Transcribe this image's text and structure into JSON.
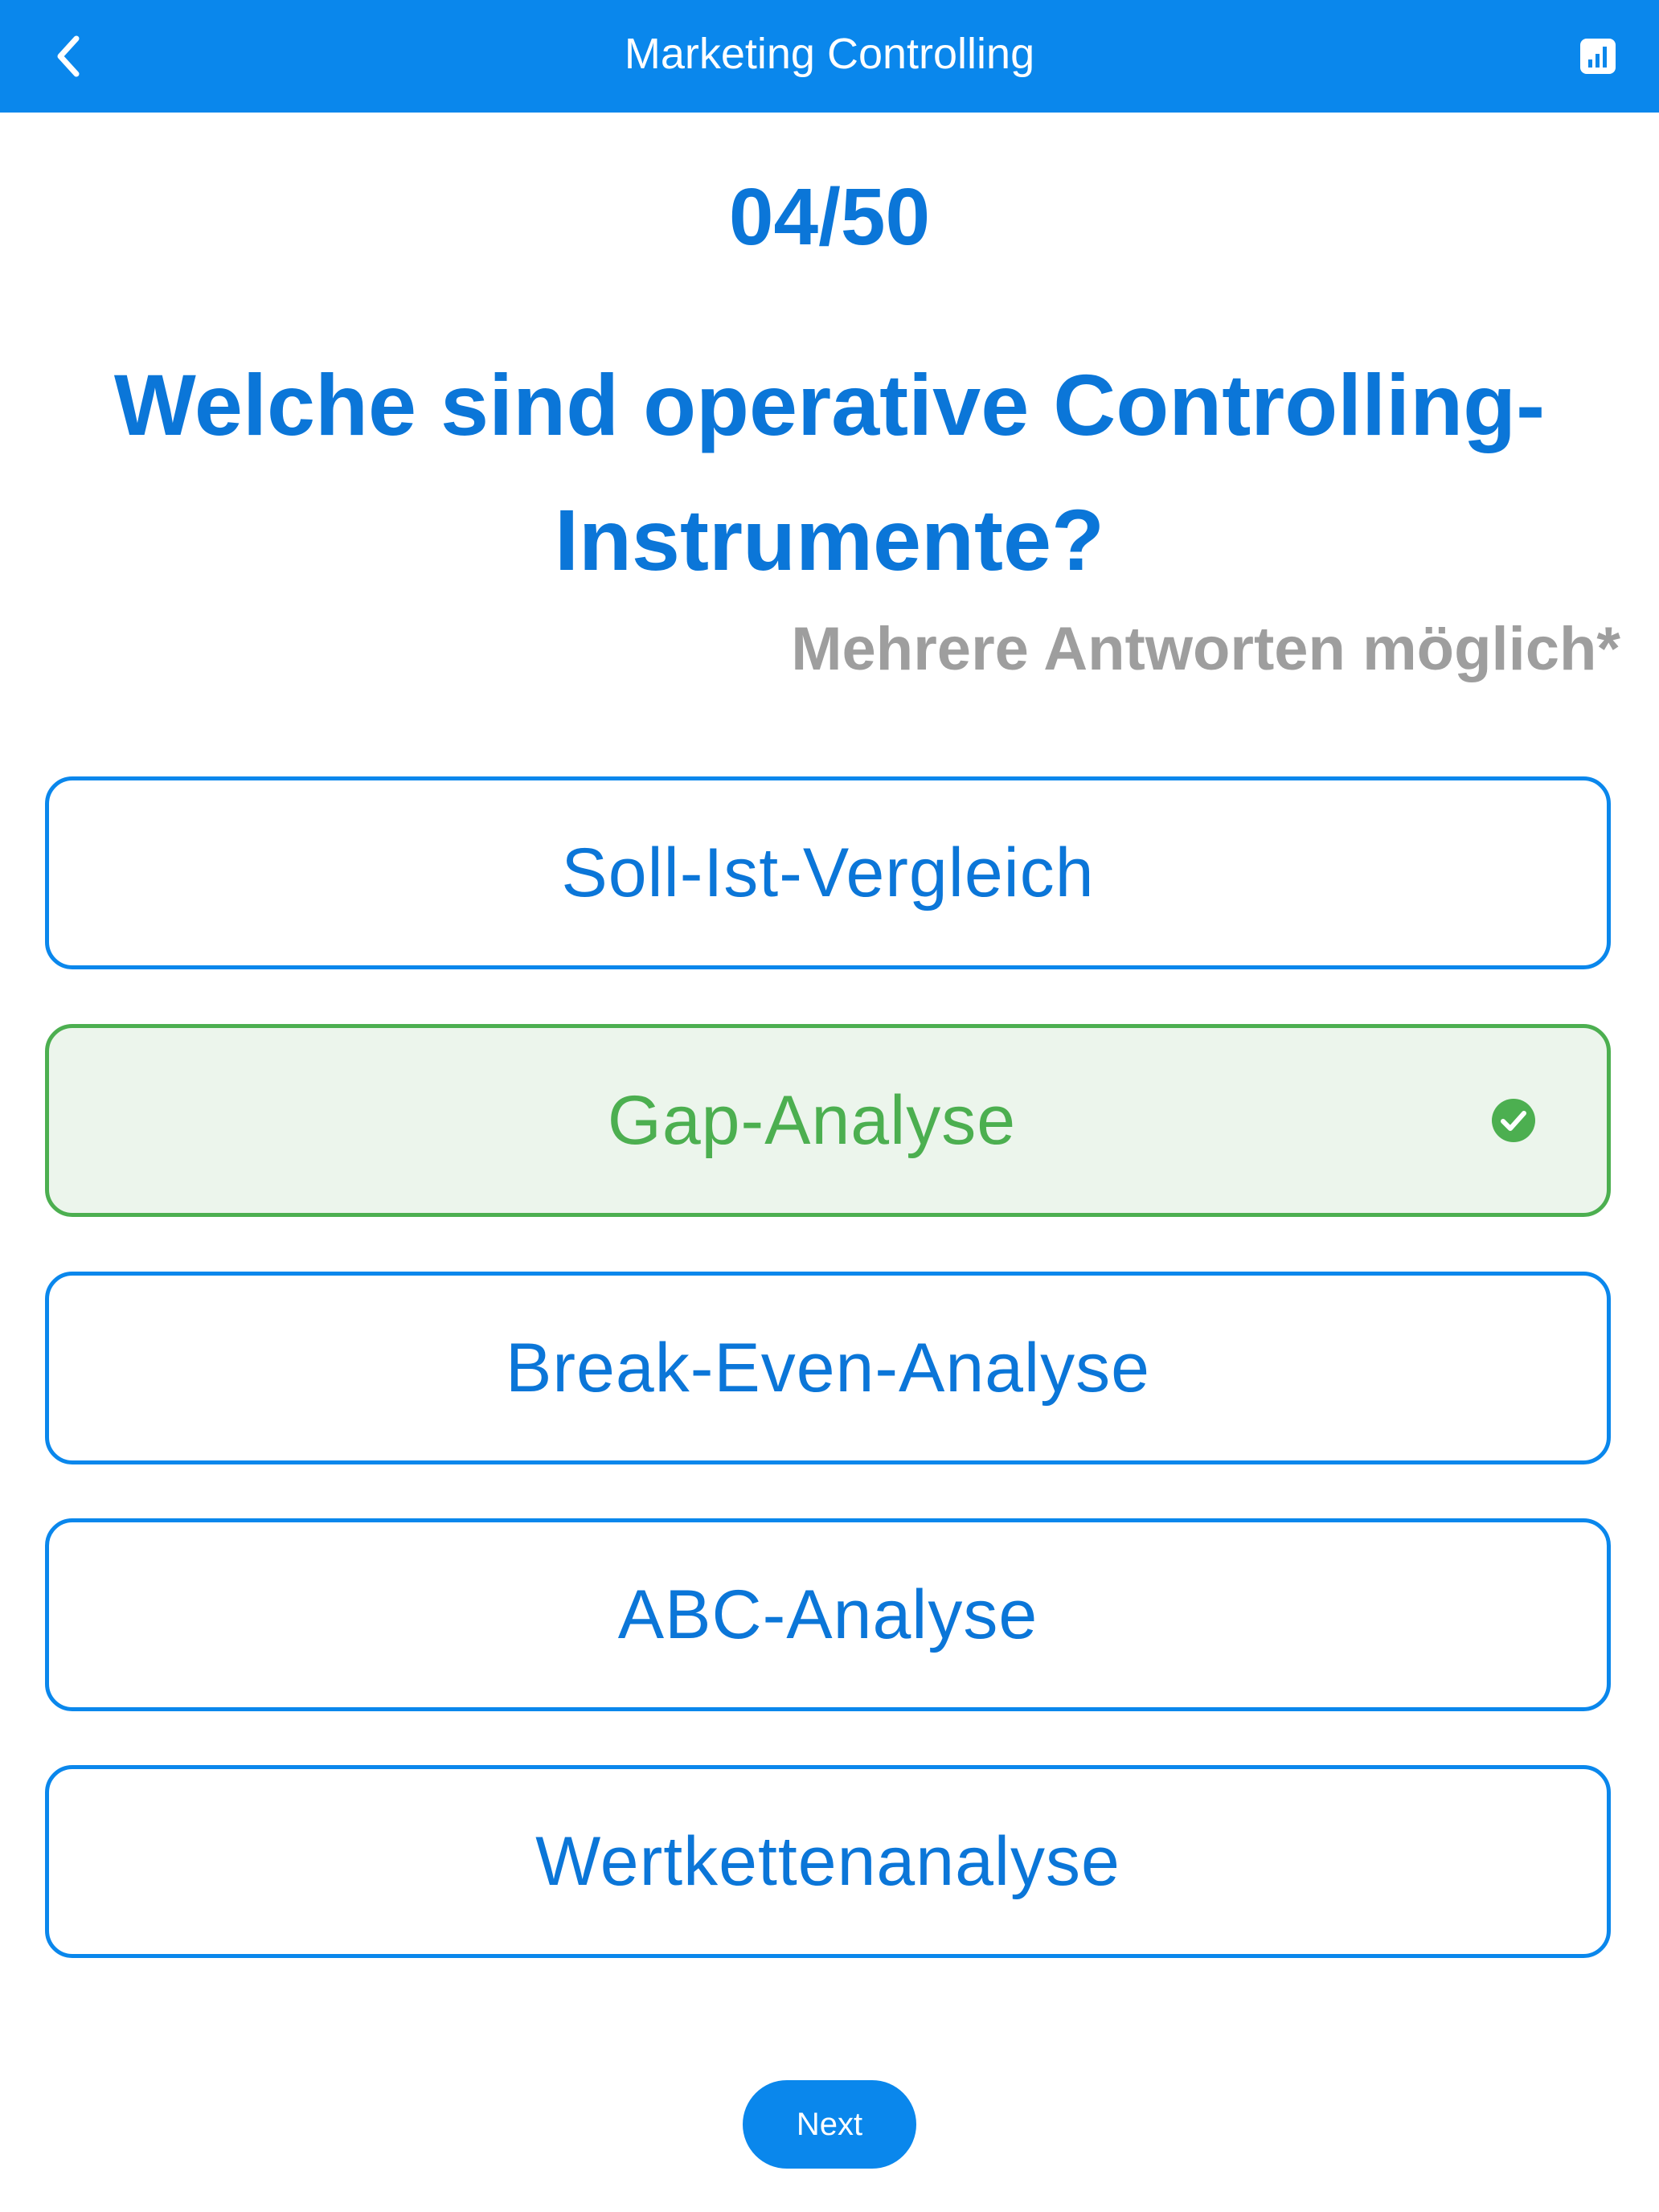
{
  "header": {
    "title": "Marketing Controlling",
    "back_icon": "chevron-left-icon",
    "stats_icon": "bar-chart-icon",
    "background_color": "#0A87EC"
  },
  "quiz": {
    "counter": "04/50",
    "question": "Welche sind operative Controlling-Instrumente?",
    "hint": "Mehrere Antworten möglich*",
    "options": [
      {
        "label": "Soll-Ist-Vergleich",
        "selected": false
      },
      {
        "label": "Gap-Analyse",
        "selected": true
      },
      {
        "label": "Break-Even-Analyse",
        "selected": false
      },
      {
        "label": "ABC-Analyse",
        "selected": false
      },
      {
        "label": "Wertkettenanalyse",
        "selected": false
      }
    ],
    "accent_color": "#0B76D8",
    "selected_color": "#4CAF50"
  },
  "footer": {
    "next_label": "Next"
  }
}
